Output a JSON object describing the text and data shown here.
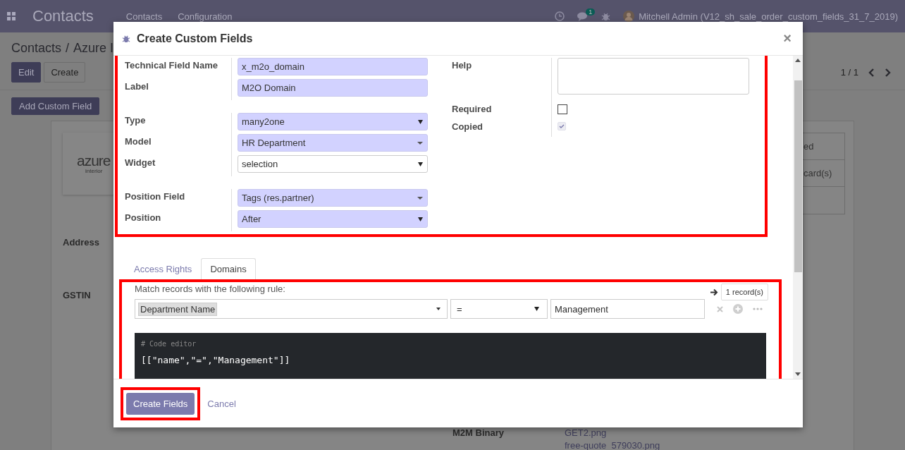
{
  "navbar": {
    "app_title": "Contacts",
    "menu": [
      "Contacts",
      "Configuration"
    ],
    "chat_count": "1",
    "user": "Mitchell Admin (V12_sh_sale_order_custom_fields_31_7_2019)"
  },
  "breadcrumb": [
    "Contacts",
    "/",
    "Azure I"
  ],
  "actions": [
    "Edit",
    "Create"
  ],
  "pager": "1 / 1",
  "add_custom_field": "Add Custom Field",
  "record": {
    "logo": {
      "name": "azure",
      "tagline": "interior"
    },
    "labels": [
      "Address",
      "GSTIN"
    ],
    "side_cells": [
      "ed",
      "card(s)"
    ],
    "bottom_label": "M2M Binary",
    "files": [
      "GET2.png",
      "free-quote_579030.png"
    ]
  },
  "dialog": {
    "title": "Create Custom Fields",
    "close": "×",
    "left_fields": [
      {
        "label": "Technical Field Name",
        "kind": "input",
        "value": "x_m2o_domain",
        "required": true,
        "spaced": false
      },
      {
        "label": "Label",
        "kind": "input",
        "value": "M2O Domain",
        "required": true,
        "spaced": false
      },
      {
        "label": "Type",
        "kind": "select",
        "value": "many2one",
        "required": true,
        "spaced": true
      },
      {
        "label": "Model",
        "kind": "relation",
        "value": "HR Department",
        "required": true,
        "spaced": false
      },
      {
        "label": "Widget",
        "kind": "select",
        "value": "selection",
        "required": false,
        "spaced": false
      },
      {
        "label": "Position Field",
        "kind": "relation",
        "value": "Tags (res.partner)",
        "required": true,
        "spaced": true
      },
      {
        "label": "Position",
        "kind": "select",
        "value": "After",
        "required": true,
        "spaced": false
      }
    ],
    "right_fields": [
      {
        "label": "Help",
        "kind": "textarea"
      },
      {
        "label": "Required",
        "kind": "checkbox",
        "checked": false,
        "disabled": false
      },
      {
        "label": "Copied",
        "kind": "checkbox",
        "checked": true,
        "disabled": true
      }
    ],
    "tabs": [
      {
        "label": "Access Rights",
        "selected": false
      },
      {
        "label": "Domains",
        "selected": true
      }
    ],
    "domain": {
      "intro": "Match records with the following rule:",
      "record_count": "1 record(s)",
      "field": "Department Name",
      "operator": "=",
      "value": "Management",
      "code_comment": "# Code editor",
      "code": "[[\"name\",\"=\",\"Management\"]]"
    },
    "footer": {
      "primary": "Create Fields",
      "secondary": "Cancel"
    }
  }
}
